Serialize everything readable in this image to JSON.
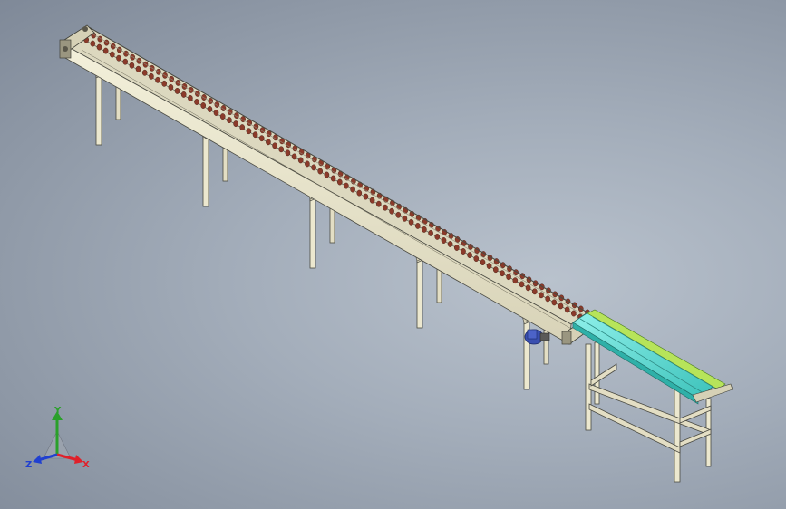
{
  "viewport": {
    "model": "belt-conveyor-assembly",
    "background": [
      "#b9c2cd",
      "#7f8998"
    ]
  },
  "colors": {
    "frame": "#ece8cf",
    "frame_edge": "#4a4a42",
    "frame_shadow": "#cfcab0",
    "roller": "#8b3a2a",
    "chute_top": "#7fe6e0",
    "chute_side": "#2fb0a8",
    "chute_rail": "#b7e45a",
    "motor": "#3a4fb0"
  },
  "triad": {
    "x_label": "X",
    "y_label": "Y",
    "z_label": "Z",
    "x_color": "#e0202a",
    "y_color": "#2aa02a",
    "z_color": "#2040d0"
  }
}
